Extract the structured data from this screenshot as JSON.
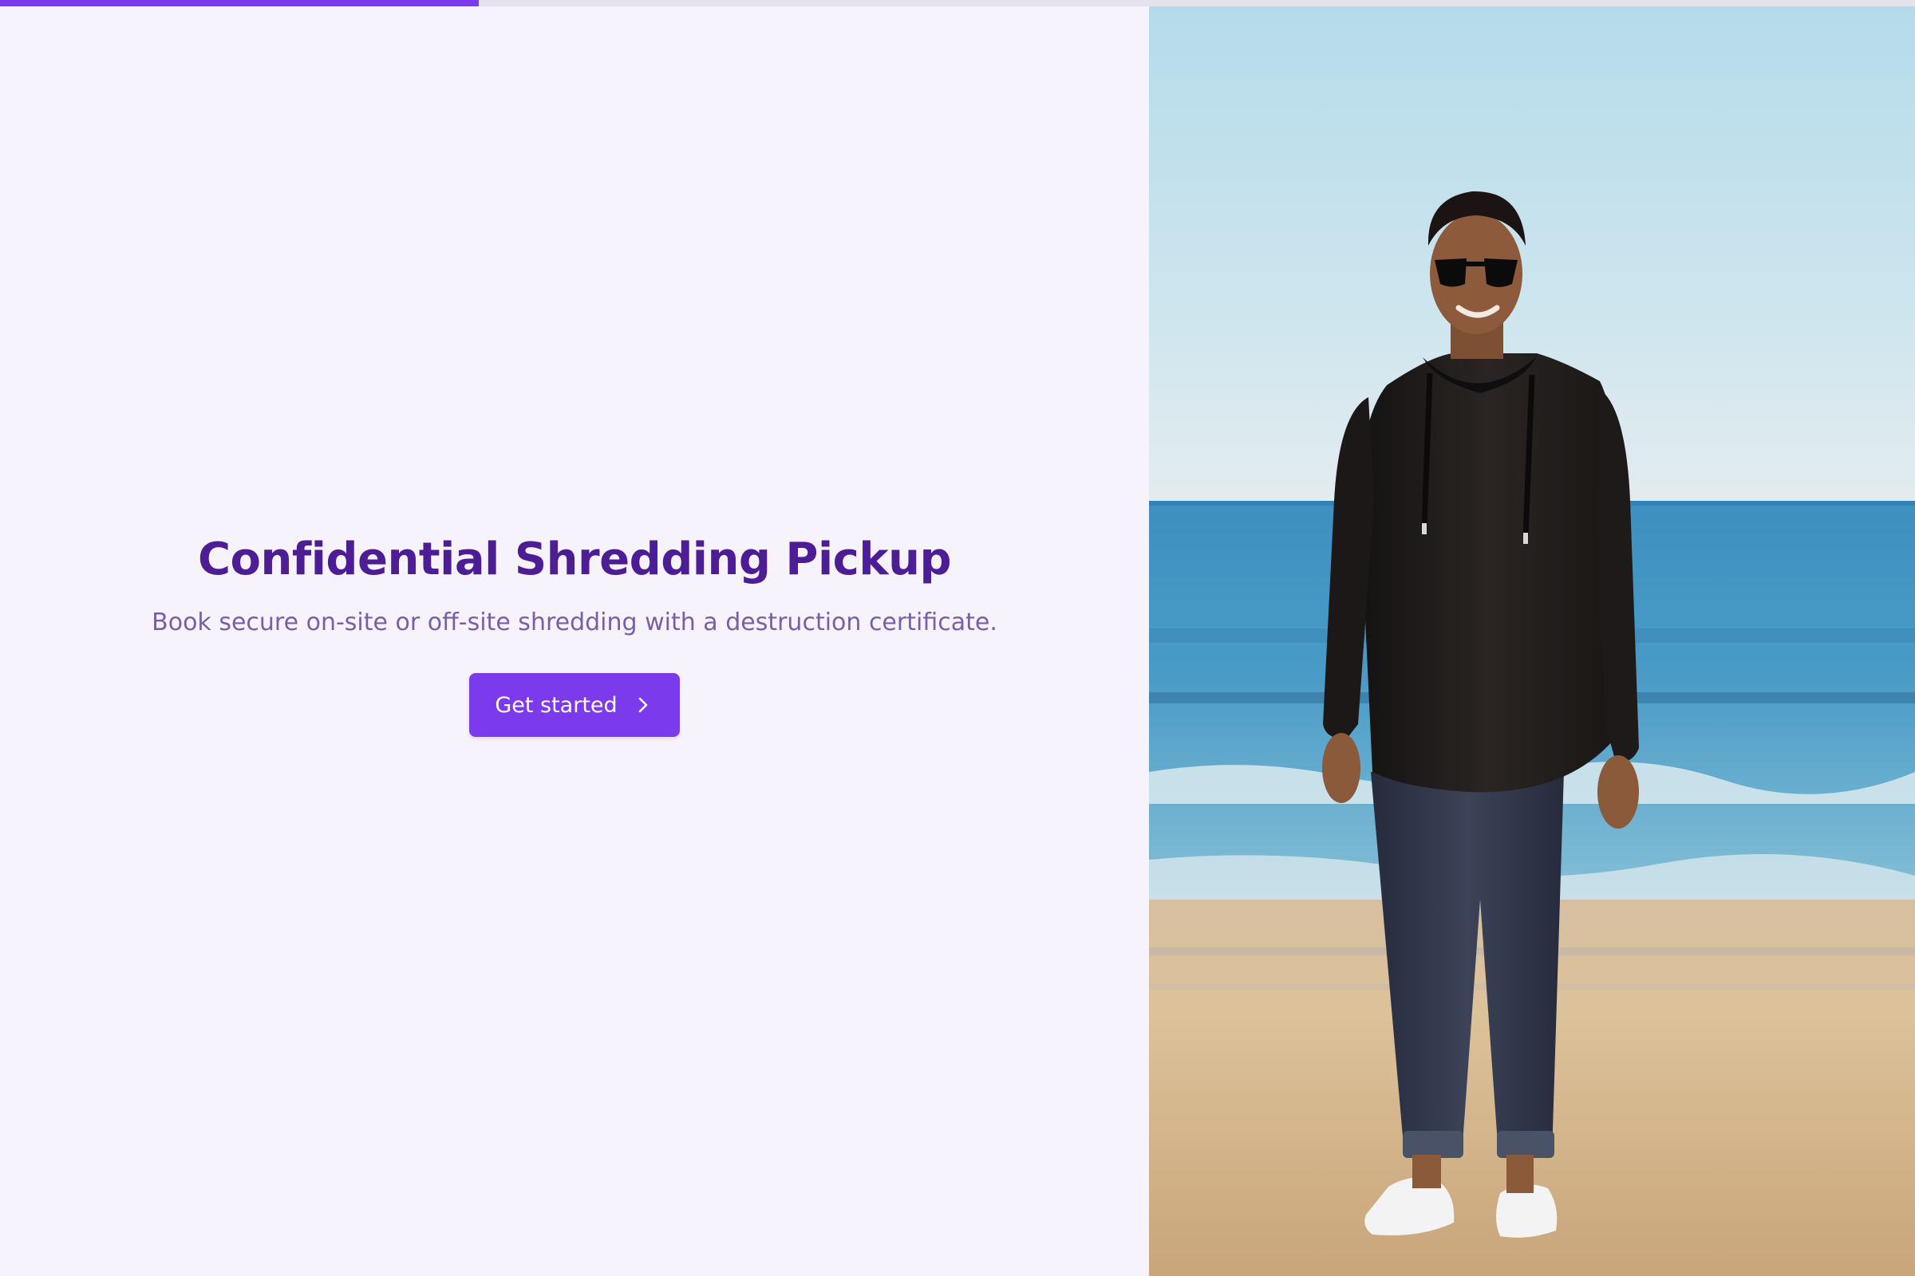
{
  "progress": {
    "fraction": 0.25
  },
  "hero": {
    "title": "Confidential Shredding Pickup",
    "subtitle": "Book secure on-site or off-site shredding with a destruction certificate.",
    "cta_label": "Get started",
    "cta_icon": "chevron-right-icon"
  },
  "image": {
    "description": "hero-photo-person-on-beach"
  },
  "colors": {
    "accent": "#7c3aed",
    "title": "#4c1d95",
    "subtitle": "#7a5ea8",
    "background": "#f6f3fd"
  }
}
